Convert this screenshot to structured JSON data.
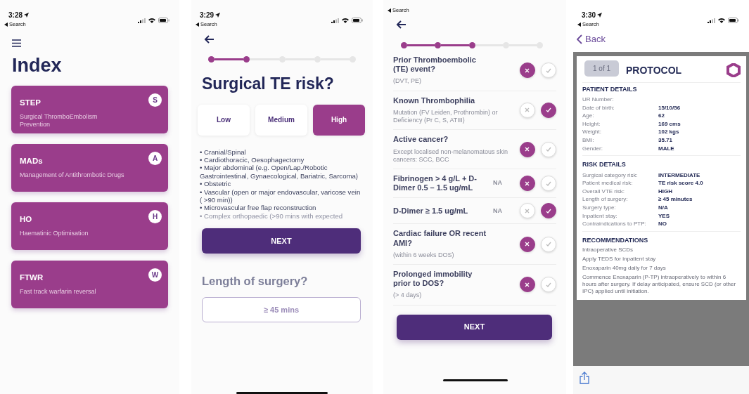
{
  "screens": [
    {
      "kind": "index",
      "status": {
        "time": "3:28",
        "back": "Search"
      },
      "title": "Index",
      "cards": [
        {
          "code": "STEP",
          "letter": "S",
          "description": "Surgical ThromboEmbolism Prevention"
        },
        {
          "code": "MADs",
          "letter": "A",
          "description": "Management of Antithrombotic Drugs"
        },
        {
          "code": "HO",
          "letter": "H",
          "description": "Haematinic Optimisation"
        },
        {
          "code": "FTWR",
          "letter": "W",
          "description": "Fast track warfarin reversal"
        }
      ]
    },
    {
      "kind": "risk",
      "status": {
        "time": "3:29",
        "back": "Search"
      },
      "steps": [
        {
          "done": true
        },
        {
          "done": true
        },
        {
          "done": false
        },
        {
          "done": false
        },
        {
          "done": false
        }
      ],
      "title": "Surgical TE risk?",
      "options": [
        {
          "label": "Low",
          "selected": false
        },
        {
          "label": "Medium",
          "selected": false
        },
        {
          "label": "High",
          "selected": true
        }
      ],
      "bullets": [
        "• Cranial/Spinal",
        "• Cardiothoracic, Oesophagectomy",
        "• Major abdominal (e.g. Open/Lap./Robotic Gastrointestinal, Gynaecological, Bariatric, Sarcoma)",
        "• Obstetric",
        "• Vascular (open or major endovascular, varicose vein ( >90 min))",
        "• Microvascular free flap reconstruction",
        "• Complex orthopaedic (>90 mins with expected"
      ],
      "next": "NEXT",
      "question": "Length of surgery?",
      "answer": "≥ 45 mins"
    },
    {
      "kind": "questions",
      "status": {
        "back": "Search"
      },
      "steps": [
        {
          "done": true
        },
        {
          "done": true
        },
        {
          "done": true
        },
        {
          "done": false
        },
        {
          "done": false
        }
      ],
      "items": [
        {
          "title": "Prior Thromboembolic (TE) event?",
          "note": "(DVT, PE)",
          "yes": false
        },
        {
          "title": "Known Thrombophilia",
          "note": "Mutation (FV Leiden, Prothrombin) or Deficiency (Pr C, S, ATIII)",
          "yes": true
        },
        {
          "title": "Active cancer?",
          "note": "Except localised non-melanomatous skin cancers: SCC, BCC",
          "yes": false
        },
        {
          "title": "Fibrinogen > 4 g/L + D-Dimer 0.5 – 1.5 ug/mL",
          "na": "NA",
          "yes": false
        },
        {
          "title": "D-Dimer ≥ 1.5 ug/mL",
          "na": "NA",
          "yes": true
        },
        {
          "title": "Cardiac failure OR recent AMI?",
          "note": "(within 6 weeks DOS)",
          "yes": false
        },
        {
          "title": "Prolonged immobility prior to DOS?",
          "note": "(> 4 days)",
          "yes": false
        }
      ],
      "next": "NEXT"
    },
    {
      "kind": "report",
      "status": {
        "time": "3:30",
        "back": "Search"
      },
      "back": "Back",
      "pager": "1 of 1",
      "doc_title": "PROTOCOL",
      "sections": [
        {
          "heading": "PATIENT DETAILS",
          "rows": [
            {
              "label": "UR Number:"
            },
            {
              "label": "Date of birth:",
              "value": "15/10/56"
            },
            {
              "label": "Age:",
              "value": "62"
            },
            {
              "label": "Height:",
              "value": "169 cms"
            },
            {
              "label": "Weight:",
              "value": "102 kgs"
            },
            {
              "label": "BMI:",
              "value": "35.71"
            },
            {
              "label": "Gender:",
              "value": "MALE"
            }
          ]
        },
        {
          "heading": "RISK DETAILS",
          "rows": [
            {
              "label": "Surgical category risk:",
              "value": "INTERMEDIATE"
            },
            {
              "label": "Patient medical risk:",
              "value": "TE risk score 4.0"
            },
            {
              "label": "Overall VTE risk:",
              "value": "HIGH"
            },
            {
              "label": "Length of surgery:",
              "value": "≥ 45 minutes"
            },
            {
              "label": "Surgery type:",
              "value": "N/A"
            },
            {
              "label": "Inpatient stay:",
              "value": "YES"
            },
            {
              "label": "Contraindications to PTP:",
              "value": "NO"
            }
          ]
        },
        {
          "heading": "RECOMMENDATIONS",
          "lines": [
            "Intraoperative SCDs",
            "Apply TEDS for inpatient stay",
            "Enoxaparin 40mg daily for 7 days",
            "Commence Enoxaparin (P-TP) intraoperatively to within 6 hours after surgery. If delay anticipated, ensure SCD (or other IPC) applied until initiation."
          ]
        }
      ]
    }
  ]
}
